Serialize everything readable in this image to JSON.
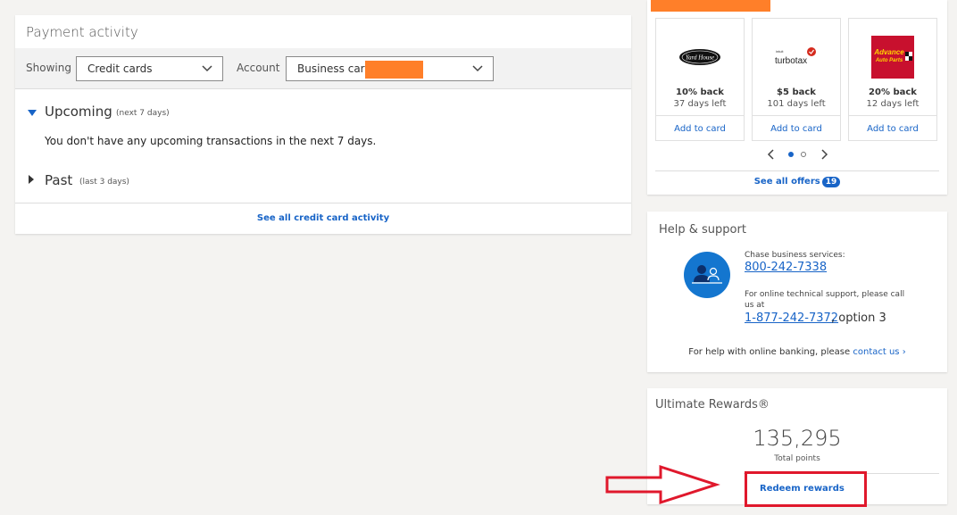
{
  "payment_activity": {
    "title": "Payment activity",
    "showing_label": "Showing",
    "showing_value": "Credit cards",
    "account_label": "Account",
    "account_value": "Business card",
    "upcoming_label": "Upcoming",
    "upcoming_sub": "(next 7 days)",
    "upcoming_message": "You don't have any upcoming transactions in the next 7 days.",
    "past_label": "Past",
    "past_sub": "(last 3 days)",
    "see_all": "See all credit card activity"
  },
  "offers": {
    "items": [
      {
        "brand": "Yard House",
        "value": "10% back",
        "days": "37 days left",
        "add": "Add to card"
      },
      {
        "brand": "turbotax",
        "brand_prefix": "intuit",
        "value": "$5 back",
        "days": "101 days left",
        "add": "Add to card"
      },
      {
        "brand_line1": "Advance",
        "brand_line2": "Auto Parts",
        "value": "20% back",
        "days": "12 days left",
        "add": "Add to card"
      }
    ],
    "see_all": "See all offers",
    "count": "19"
  },
  "help": {
    "title": "Help & support",
    "biz_label": "Chase business services:",
    "biz_phone": "800-242-7338",
    "tech_label_1": "For online technical support, please call",
    "tech_label_2": "us at",
    "tech_phone": "1-877-242-7372",
    "tech_option": ", option 3",
    "online_help": "For help with online banking, please",
    "contact_link": "contact us",
    "contact_chevron": "›"
  },
  "rewards": {
    "title": "Ultimate Rewards®",
    "points": "135,295",
    "points_label": "Total points",
    "redeem": "Redeem rewards"
  },
  "colors": {
    "accent": "#1864c7",
    "redaction": "#ff7f29",
    "annotation": "#e0182c"
  },
  "icons": [
    "chevron-down-icon",
    "triangle-down-icon",
    "triangle-right-icon",
    "chevron-left-icon",
    "chevron-right-icon",
    "support-agent-icon"
  ]
}
